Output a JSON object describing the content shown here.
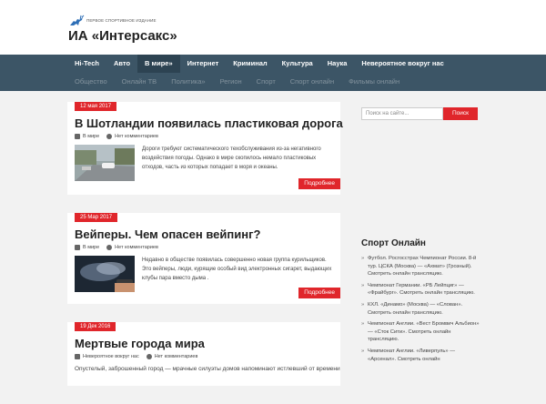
{
  "logo": {
    "tagline": "ПЕРВОЕ СПОРТИВНОЕ ИЗДАНИЕ",
    "title": "ИА «Интерсакс»"
  },
  "nav": {
    "primary": [
      "Hi-Tech",
      "Авто",
      "В мире»",
      "Интернет",
      "Криминал",
      "Культура",
      "Наука",
      "Невероятное вокруг нас"
    ],
    "secondary": [
      "Общество",
      "Онлайн ТВ",
      "Политика»",
      "Регион",
      "Спорт",
      "Спорт онлайн",
      "Фильмы онлайн"
    ],
    "active_index": 2
  },
  "posts": [
    {
      "date": "12 мая 2017",
      "title": "В Шотландии появилась пластиковая дорога",
      "category": "В мире",
      "comments": "Нет комментариев",
      "excerpt": "Дороги требуют систематического техобслуживания из-за негативного воздействия погоды. Однако в мире скопилось немало пластиковых отходов, часть из которых попадает в моря и океаны.",
      "more": "Подробнее"
    },
    {
      "date": "25 Мар 2017",
      "title": "Вейперы. Чем опасен вейпинг?",
      "category": "В мире",
      "comments": "Нет комментариев",
      "excerpt": "Недавно в обществе появилась совершенно новая группа курильщиков. Это вейперы, люди, курящие особый вид электронных сигарет, выдающих клубы пара вместо дыма .",
      "more": "Подробнее"
    },
    {
      "date": "19 Дек 2016",
      "title": "Мертвые города мира",
      "category": "Невероятное вокруг нас",
      "comments": "Нет комментариев",
      "excerpt": "Опустелый, заброшенный город — мрачные силуэты домов напоминают истлевший от времени"
    }
  ],
  "sidebar": {
    "search_placeholder": "Поиск на сайте...",
    "search_button": "Поиск",
    "widget_title": "Спорт Онлайн",
    "items": [
      "Футбол. Росгосстрах Чемпионат России. 8-й тур. ЦСКА (Москва) — «Ахмат» (Грозный). Смотреть онлайн трансляцию.",
      "Чемпионат Германии. «РБ Лейпциг» — «Фрайбург». Смотреть онлайн трансляцию.",
      "КХЛ. «Динамо» (Москва) — «Слован». Смотреть онлайн трансляцию.",
      "Чемпионат Англии. «Вест Бромвич Альбион» — «Сток Сити». Смотреть онлайн трансляцию.",
      "Чемпионат Англии. «Ливерпуль» — «Арсенал». Смотреть онлайн"
    ]
  },
  "colors": {
    "nav_bg": "#3c5566",
    "accent": "#e0262b"
  }
}
